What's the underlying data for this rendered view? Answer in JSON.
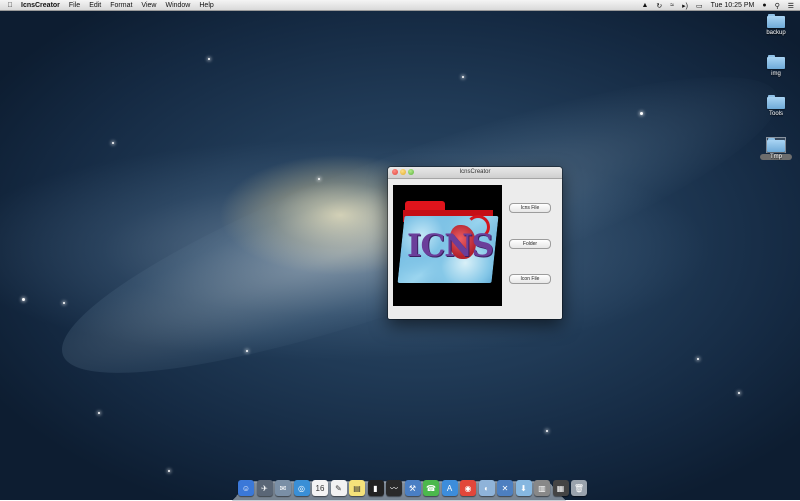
{
  "menubar": {
    "app_name": "IcnsCreator",
    "menus": [
      "File",
      "Edit",
      "Format",
      "View",
      "Window",
      "Help"
    ],
    "clock": "Tue 10:25 PM"
  },
  "desktop": {
    "icons": [
      {
        "label": "backup"
      },
      {
        "label": "img"
      },
      {
        "label": "Tools"
      },
      {
        "label": "Tmp"
      }
    ]
  },
  "window": {
    "title": "IcnsCreator",
    "preview_text": "ICNS",
    "buttons": {
      "icns_file": "Icns File",
      "folder": "Folder",
      "icon_file": "Icon File"
    }
  },
  "dock": {
    "apps": [
      {
        "icon": "finder-icon",
        "color": "#3b78d8",
        "glyph": "☺"
      },
      {
        "icon": "launchpad-icon",
        "color": "#5a6676",
        "glyph": "✈"
      },
      {
        "icon": "mail-icon",
        "color": "#7a8fa6",
        "glyph": "✉"
      },
      {
        "icon": "safari-icon",
        "color": "#3a8fd6",
        "glyph": "◎"
      },
      {
        "icon": "calendar-icon",
        "color": "#f4f4f4",
        "glyph": "16"
      },
      {
        "icon": "textedit-icon",
        "color": "#f2f2f2",
        "glyph": "✎"
      },
      {
        "icon": "stickies-icon",
        "color": "#f4e27a",
        "glyph": "▤"
      },
      {
        "icon": "terminal-icon",
        "color": "#222222",
        "glyph": "▮"
      },
      {
        "icon": "activity-monitor-icon",
        "color": "#2a2a2a",
        "glyph": "〰"
      },
      {
        "icon": "xcode-icon",
        "color": "#4a7fc4",
        "glyph": "⚒"
      },
      {
        "icon": "facetime-icon",
        "color": "#4cb84c",
        "glyph": "☎"
      },
      {
        "icon": "app-store-icon",
        "color": "#3d8ddb",
        "glyph": "A"
      },
      {
        "icon": "chrome-icon",
        "color": "#e2463a",
        "glyph": "◉"
      },
      {
        "icon": "preview-icon",
        "color": "#8fb3d9",
        "glyph": "◐"
      },
      {
        "icon": "icnscreator-icon",
        "color": "#4d7fc0",
        "glyph": "✕"
      },
      {
        "icon": "downloads-folder-icon",
        "color": "#86b7e0",
        "glyph": "⬇"
      },
      {
        "icon": "documents-icon",
        "color": "#888888",
        "glyph": "▥"
      },
      {
        "icon": "stack-icon",
        "color": "#444444",
        "glyph": "▦"
      },
      {
        "icon": "trash-icon",
        "color": "#9aa3ad",
        "glyph": "🗑"
      }
    ]
  }
}
